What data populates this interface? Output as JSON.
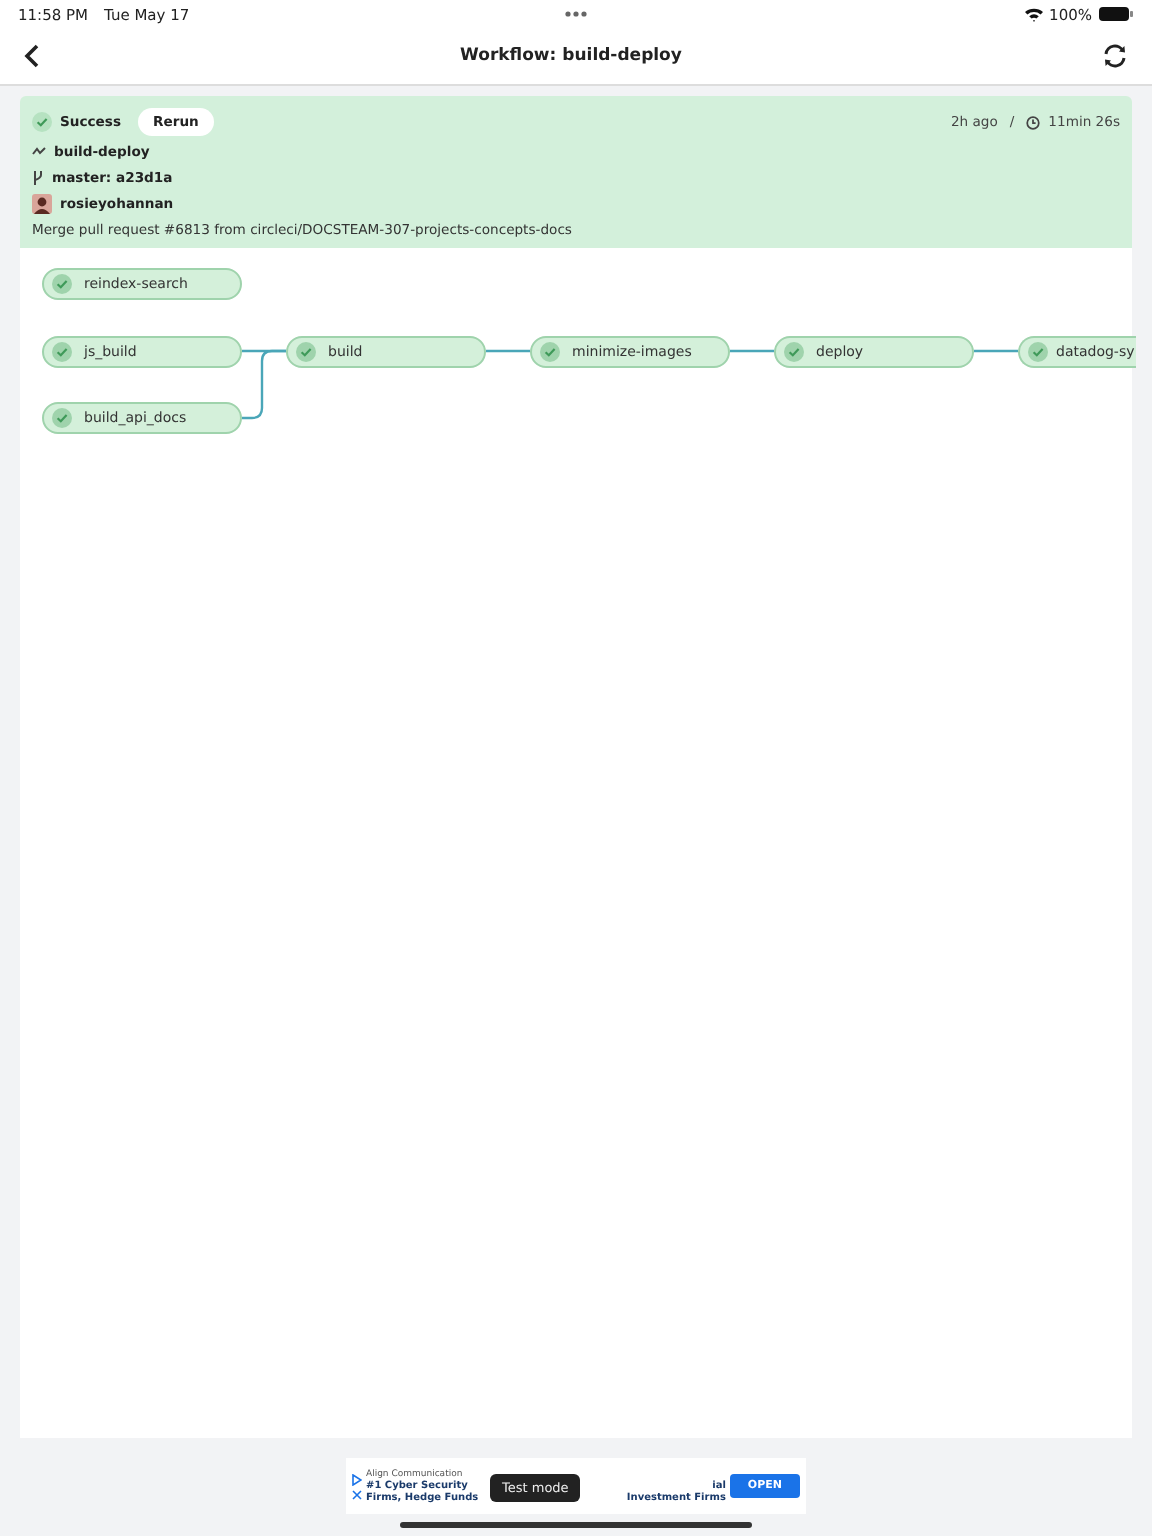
{
  "status_bar": {
    "time": "11:58 PM",
    "date": "Tue May 17",
    "battery": "100%"
  },
  "nav": {
    "title": "Workflow: build-deploy"
  },
  "summary": {
    "status": "Success",
    "rerun": "Rerun",
    "ago": "2h ago",
    "separator": "/",
    "duration": "11min 26s",
    "workflow": "build-deploy",
    "branch": "master: a23d1a",
    "user": "rosieyohannan",
    "message": "Merge pull request #6813 from circleci/DOCSTEAM-307-projects-concepts-docs"
  },
  "job_columns": [
    [
      {
        "name": "reindex-search",
        "passed": true
      },
      {
        "name": "js_build",
        "passed": true
      },
      {
        "name": "build_api_docs",
        "passed": true
      }
    ],
    [
      {
        "name": "build",
        "passed": true
      }
    ],
    [
      {
        "name": "minimize-images",
        "passed": true
      }
    ],
    [
      {
        "name": "deploy",
        "passed": true
      }
    ],
    [
      {
        "name": "datadog-sy",
        "passed": true
      }
    ]
  ],
  "ad": {
    "advertiser": "Align Communication",
    "line1_start": "#1 Cyber Security",
    "line1_end": "ial",
    "line2_start": "Firms, Hedge Funds",
    "line2_end": "Investment Firms",
    "open": "OPEN"
  },
  "toast": "Test mode"
}
